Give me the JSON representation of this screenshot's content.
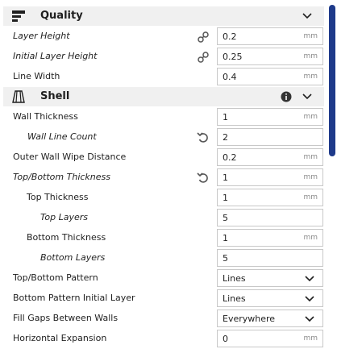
{
  "sections": {
    "quality": {
      "title": "Quality",
      "icon": "quality-layers-icon"
    },
    "shell": {
      "title": "Shell",
      "icon": "shell-icon"
    }
  },
  "settings": {
    "layer_height": {
      "label": "Layer Height",
      "value": "0.2",
      "unit": "mm"
    },
    "initial_layer_height": {
      "label": "Initial Layer Height",
      "value": "0.25",
      "unit": "mm"
    },
    "line_width": {
      "label": "Line Width",
      "value": "0.4",
      "unit": "mm"
    },
    "wall_thickness": {
      "label": "Wall Thickness",
      "value": "1",
      "unit": "mm"
    },
    "wall_line_count": {
      "label": "Wall Line Count",
      "value": "2"
    },
    "outer_wall_wipe_distance": {
      "label": "Outer Wall Wipe Distance",
      "value": "0.2",
      "unit": "mm"
    },
    "top_bottom_thickness": {
      "label": "Top/Bottom Thickness",
      "value": "1",
      "unit": "mm"
    },
    "top_thickness": {
      "label": "Top Thickness",
      "value": "1",
      "unit": "mm"
    },
    "top_layers": {
      "label": "Top Layers",
      "value": "5"
    },
    "bottom_thickness": {
      "label": "Bottom Thickness",
      "value": "1",
      "unit": "mm"
    },
    "bottom_layers": {
      "label": "Bottom Layers",
      "value": "5"
    },
    "top_bottom_pattern": {
      "label": "Top/Bottom Pattern",
      "value": "Lines"
    },
    "bottom_pattern_initial_layer": {
      "label": "Bottom Pattern Initial Layer",
      "value": "Lines"
    },
    "fill_gaps_between_walls": {
      "label": "Fill Gaps Between Walls",
      "value": "Everywhere"
    },
    "horizontal_expansion": {
      "label": "Horizontal Expansion",
      "value": "0",
      "unit": "mm"
    }
  },
  "colors": {
    "accent": "#1e3a8a",
    "section_bg": "#f0f0f0",
    "field_border": "#c8c8c8"
  }
}
